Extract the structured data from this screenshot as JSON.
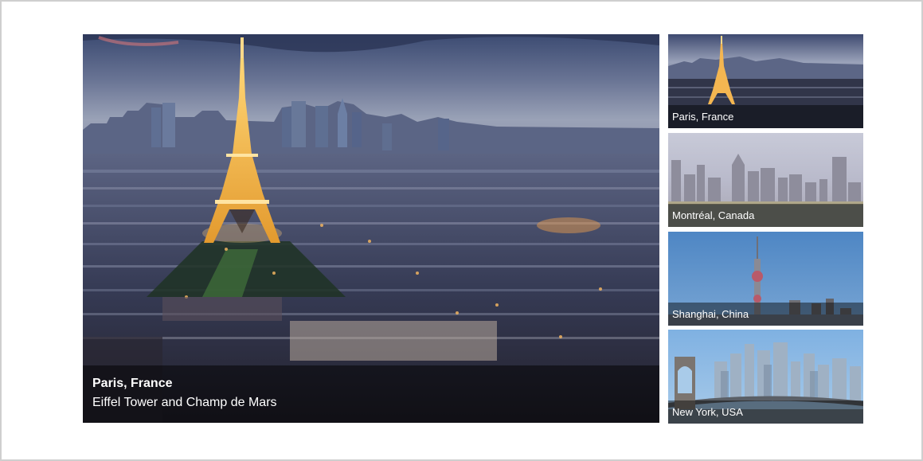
{
  "slider": {
    "main": {
      "title": "Paris, France",
      "subtitle": "Eiffel Tower and Champ de Mars"
    },
    "thumbnails": [
      {
        "label": "Paris, France"
      },
      {
        "label": "Montréal, Canada"
      },
      {
        "label": "Shanghai, China"
      },
      {
        "label": "New York, USA"
      }
    ]
  }
}
